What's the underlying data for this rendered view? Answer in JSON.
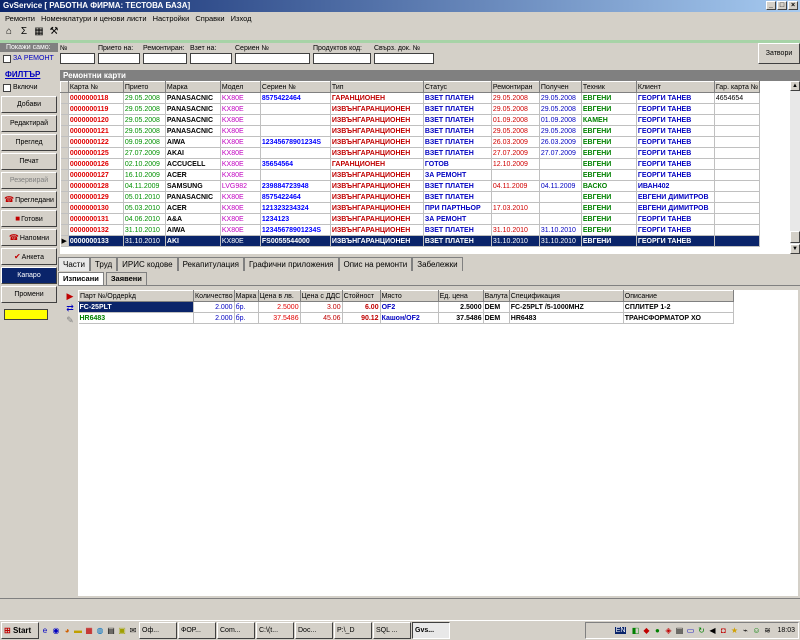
{
  "app": {
    "title": "GvService  [ РАБОТНА ФИРМА: ТЕСТОВА БАЗА]"
  },
  "menu": [
    "Ремонти",
    "Номенклатури и ценови листи",
    "Настройки",
    "Справки",
    "Изход"
  ],
  "show_only": {
    "header": "Покажи само:",
    "za_remont_label": "ЗА РЕМОНТ"
  },
  "filter_fields": [
    {
      "label": "№",
      "value": ""
    },
    {
      "label": "Прието на:",
      "value": ""
    },
    {
      "label": "Ремонтиран:",
      "value": ""
    },
    {
      "label": "Взет на:",
      "value": ""
    },
    {
      "label": "Сериен №",
      "value": ""
    },
    {
      "label": "Продуктов код:",
      "value": ""
    },
    {
      "label": "Свърз. док. №",
      "value": ""
    }
  ],
  "close_label": "Затвори",
  "sidebar": {
    "filter_title": "ФИЛТЪР",
    "include_label": "Включи",
    "buttons": [
      {
        "label": "Добави",
        "icon": ""
      },
      {
        "label": "Редактирай",
        "icon": ""
      },
      {
        "label": "Преглед",
        "icon": ""
      },
      {
        "label": "Печат",
        "icon": ""
      },
      {
        "label": "Резервирай",
        "icon": ""
      },
      {
        "label": "Прегледани",
        "icon": "phone-icon"
      },
      {
        "label": "Готови",
        "icon": "car-icon"
      },
      {
        "label": "Напомни",
        "icon": "phone-icon"
      },
      {
        "label": "Анкета",
        "icon": "check-icon"
      },
      {
        "label": "Капаро",
        "icon": ""
      },
      {
        "label": "Промени",
        "icon": ""
      }
    ]
  },
  "repair_cards": {
    "title": "Ремонтни карти",
    "columns": [
      "Карта №",
      "Прието",
      "Марка",
      "Модел",
      "Сериен №",
      "Тип",
      "Статус",
      "Ремонтиран",
      "Получен",
      "Техник",
      "Клиент",
      "Гар. карта №"
    ],
    "rows": [
      [
        "0000000118",
        "29.05.2008",
        "PANASACNIC",
        "KX80E",
        "8575422464",
        "ГАРАНЦИОНЕН",
        "ВЗЕТ ПЛАТЕН",
        "29.05.2008",
        "29.05.2008",
        "ЕВГЕНИ",
        "ГЕОРГИ ТАНЕВ",
        "4654654"
      ],
      [
        "0000000119",
        "29.05.2008",
        "PANASACNIC",
        "KX80E",
        "",
        "ИЗВЪНГАРАНЦИОНЕН",
        "ВЗЕТ ПЛАТЕН",
        "29.05.2008",
        "29.05.2008",
        "ЕВГЕНИ",
        "ГЕОРГИ ТАНЕВ",
        ""
      ],
      [
        "0000000120",
        "29.05.2008",
        "PANASACNIC",
        "KX80E",
        "",
        "ИЗВЪНГАРАНЦИОНЕН",
        "ВЗЕТ ПЛАТЕН",
        "01.09.2008",
        "01.09.2008",
        "КАМЕН",
        "ГЕОРГИ ТАНЕВ",
        ""
      ],
      [
        "0000000121",
        "29.05.2008",
        "PANASACNIC",
        "KX80E",
        "",
        "ИЗВЪНГАРАНЦИОНЕН",
        "ВЗЕТ ПЛАТЕН",
        "29.05.2008",
        "29.05.2008",
        "ЕВГЕНИ",
        "ГЕОРГИ ТАНЕВ",
        ""
      ],
      [
        "0000000122",
        "09.09.2008",
        "AIWA",
        "KX80E",
        "12345678901234S",
        "ИЗВЪНГАРАНЦИОНЕН",
        "ВЗЕТ ПЛАТЕН",
        "26.03.2009",
        "26.03.2009",
        "ЕВГЕНИ",
        "ГЕОРГИ ТАНЕВ",
        ""
      ],
      [
        "0000000125",
        "27.07.2009",
        "AKAI",
        "KX80E",
        "",
        "ИЗВЪНГАРАНЦИОНЕН",
        "ВЗЕТ ПЛАТЕН",
        "27.07.2009",
        "27.07.2009",
        "ЕВГЕНИ",
        "ГЕОРГИ ТАНЕВ",
        ""
      ],
      [
        "0000000126",
        "02.10.2009",
        "ACCUCELL",
        "KX80E",
        "35654564",
        "ГАРАНЦИОНЕН",
        "ГОТОВ",
        "12.10.2009",
        "",
        "ЕВГЕНИ",
        "ГЕОРГИ ТАНЕВ",
        ""
      ],
      [
        "0000000127",
        "16.10.2009",
        "ACER",
        "KX80E",
        "",
        "ИЗВЪНГАРАНЦИОНЕН",
        "ЗА РЕМОНТ",
        "",
        "",
        "ЕВГЕНИ",
        "ГЕОРГИ ТАНЕВ",
        ""
      ],
      [
        "0000000128",
        "04.11.2009",
        "SAMSUNG",
        "LVG982",
        "239884723948",
        "ИЗВЪНГАРАНЦИОНЕН",
        "ВЗЕТ ПЛАТЕН",
        "04.11.2009",
        "04.11.2009",
        "ВАСКО",
        "ИВАН402",
        ""
      ],
      [
        "0000000129",
        "05.01.2010",
        "PANASACNIC",
        "KX80E",
        "8575422464",
        "ИЗВЪНГАРАНЦИОНЕН",
        "ВЗЕТ ПЛАТЕН",
        "",
        "",
        "ЕВГЕНИ",
        "ЕВГЕНИ ДИМИТРОВ",
        ""
      ],
      [
        "0000000130",
        "05.03.2010",
        "ACER",
        "KX80E",
        "121323234324",
        "ИЗВЪНГАРАНЦИОНЕН",
        "ПРИ ПАРТНЬОР",
        "17.03.2010",
        "",
        "ЕВГЕНИ",
        "ЕВГЕНИ ДИМИТРОВ",
        ""
      ],
      [
        "0000000131",
        "04.06.2010",
        "A&A",
        "KX80E",
        "1234123",
        "ИЗВЪНГАРАНЦИОНЕН",
        "ЗА РЕМОНТ",
        "",
        "",
        "ЕВГЕНИ",
        "ГЕОРГИ ТАНЕВ",
        ""
      ],
      [
        "0000000132",
        "31.10.2010",
        "AIWA",
        "KX80E",
        "12345678901234S",
        "ИЗВЪНГАРАНЦИОНЕН",
        "ВЗЕТ ПЛАТЕН",
        "31.10.2010",
        "31.10.2010",
        "ЕВГЕНИ",
        "ГЕОРГИ ТАНЕВ",
        ""
      ],
      [
        "0000000133",
        "31.10.2010",
        "AKI",
        "KX80E",
        "FS0055544000",
        "ИЗВЪНГАРАНЦИОНЕН",
        "ВЗЕТ ПЛАТЕН",
        "31.10.2010",
        "31.10.2010",
        "ЕВГЕНИ",
        "ГЕОРГИ ТАНЕВ",
        ""
      ]
    ]
  },
  "tabs": [
    "Части",
    "Труд",
    "ИРИС кодове",
    "Рекапитулация",
    "Графични приложения",
    "Опис на ремонти",
    "Забележки"
  ],
  "subtabs": [
    "Изписани",
    "Заявени"
  ],
  "parts": {
    "columns": [
      "Парт №/Ордерkд",
      "Количество",
      "Марка",
      "Цена в лв.",
      "Цена с ДДС",
      "Стойност",
      "Място",
      "Ед. цена",
      "Валута",
      "Спецификация",
      "Описание"
    ],
    "rows": [
      [
        "FC-25PLT",
        "2.000",
        "бр.",
        "2.5000",
        "3.00",
        "6.00",
        "OF2",
        "2.5000",
        "DEM",
        "FC-25PLT   /5-1000MHZ",
        "СПЛИТЕР 1-2"
      ],
      [
        "HR6483",
        "2.000",
        "бр.",
        "37.5486",
        "45.06",
        "90.12",
        "Кашон/OF2",
        "37.5486",
        "DEM",
        "HR6483",
        "ТРАНСФОРМАТОР ХО"
      ]
    ]
  },
  "taskbar": {
    "start_label": "Start",
    "tasks": [
      "Оф...",
      "ФОР...",
      "Com...",
      "C:\\(t...",
      "Doc...",
      "P:\\_D",
      "SQL ...",
      "Gvs..."
    ],
    "language": "EN",
    "clock": "18:03"
  }
}
